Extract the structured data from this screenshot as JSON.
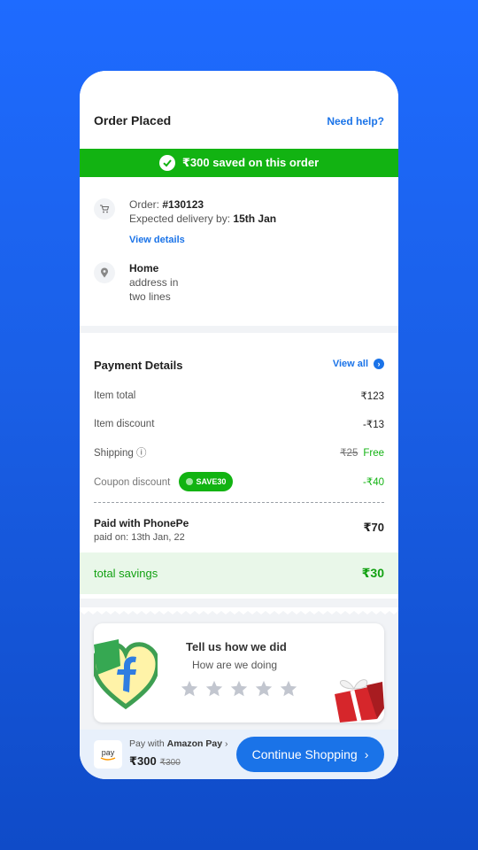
{
  "header": {
    "title": "Order Placed",
    "help_label": "Need help?"
  },
  "savings_banner": {
    "text": "₹300 saved on this order",
    "color": "#12b312"
  },
  "order": {
    "number_label": "Order:",
    "number": "#130123",
    "delivery_label": "Expected delivery by:",
    "delivery_date": "15th Jan",
    "view_details_label": "View details",
    "address_title": "Home",
    "address_line1": "address in",
    "address_line2": "two lines"
  },
  "payment": {
    "title": "Payment Details",
    "view_all_label": "View all",
    "rows": [
      {
        "label": "Item total",
        "value": "₹123"
      },
      {
        "label": "Item discount",
        "value": "-₹13"
      },
      {
        "label": "Shipping ⓘ",
        "old_value": "₹25",
        "value": "Free"
      },
      {
        "label": "Coupon discount",
        "coupon": "SAVE30",
        "value": "-₹40"
      }
    ],
    "paid_title": "Paid with PhonePe",
    "paid_sub": "paid on: 13th Jan, 22",
    "paid_amount": "₹70",
    "total_label": "total savings",
    "total_amount": "₹30"
  },
  "feedback": {
    "title": "Tell us how we did",
    "subtitle": "How are we doing",
    "stars": 5,
    "icons": [
      "flipkart-logo-heart",
      "gift-box-icon"
    ]
  },
  "bottom_bar": {
    "pay_box_text": "pay",
    "pay_with_label": "Pay with",
    "pay_provider": "Amazon Pay",
    "price": "₹300",
    "old_price": "₹300",
    "cta_label": "Continue Shopping",
    "accent": "#1a73e8"
  }
}
